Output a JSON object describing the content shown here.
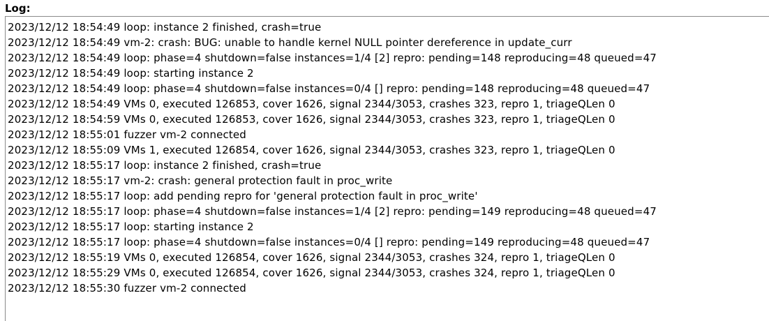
{
  "log": {
    "heading": "Log:",
    "lines": [
      "2023/12/12 18:54:49 loop: instance 2 finished, crash=true",
      "2023/12/12 18:54:49 vm-2: crash: BUG: unable to handle kernel NULL pointer dereference in update_curr",
      "2023/12/12 18:54:49 loop: phase=4 shutdown=false instances=1/4 [2] repro: pending=148 reproducing=48 queued=47",
      "2023/12/12 18:54:49 loop: starting instance 2",
      "2023/12/12 18:54:49 loop: phase=4 shutdown=false instances=0/4 [] repro: pending=148 reproducing=48 queued=47",
      "2023/12/12 18:54:49 VMs 0, executed 126853, cover 1626, signal 2344/3053, crashes 323, repro 1, triageQLen 0",
      "2023/12/12 18:54:59 VMs 0, executed 126853, cover 1626, signal 2344/3053, crashes 323, repro 1, triageQLen 0",
      "2023/12/12 18:55:01 fuzzer vm-2 connected",
      "2023/12/12 18:55:09 VMs 1, executed 126854, cover 1626, signal 2344/3053, crashes 323, repro 1, triageQLen 0",
      "2023/12/12 18:55:17 loop: instance 2 finished, crash=true",
      "2023/12/12 18:55:17 vm-2: crash: general protection fault in proc_write",
      "2023/12/12 18:55:17 loop: add pending repro for 'general protection fault in proc_write'",
      "2023/12/12 18:55:17 loop: phase=4 shutdown=false instances=1/4 [2] repro: pending=149 reproducing=48 queued=47",
      "2023/12/12 18:55:17 loop: starting instance 2",
      "2023/12/12 18:55:17 loop: phase=4 shutdown=false instances=0/4 [] repro: pending=149 reproducing=48 queued=47",
      "2023/12/12 18:55:19 VMs 0, executed 126854, cover 1626, signal 2344/3053, crashes 324, repro 1, triageQLen 0",
      "2023/12/12 18:55:29 VMs 0, executed 126854, cover 1626, signal 2344/3053, crashes 324, repro 1, triageQLen 0",
      "2023/12/12 18:55:30 fuzzer vm-2 connected"
    ]
  }
}
